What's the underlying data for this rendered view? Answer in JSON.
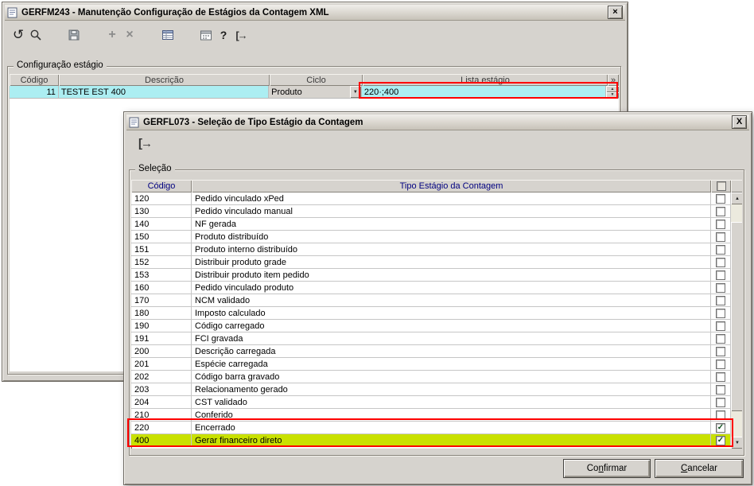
{
  "colors": {
    "annotation": "#ff0000",
    "selection_bg": "#aceef2",
    "highlight_row_bg": "#c9e100",
    "header_text": "#000080"
  },
  "glyphs": {
    "close": "×",
    "close2": "X",
    "refresh": "↺",
    "add": "+",
    "delete": "×",
    "help": "?",
    "exit": "[→",
    "up": "▲",
    "down": "▼",
    "check": "✓",
    "extra_col": "»"
  },
  "window1": {
    "title": "GERFM243 - Manutenção Configuração de Estágios da Contagem XML",
    "groupbox_label": "Configuração estágio",
    "grid": {
      "headers": {
        "codigo": "Código",
        "descricao": "Descrição",
        "ciclo": "Ciclo",
        "lista": "Lista estágio"
      },
      "row": {
        "codigo": "11",
        "descricao": "TESTE EST 400",
        "ciclo": "Produto",
        "lista": "220·;400"
      }
    }
  },
  "window2": {
    "title": "GERFL073 - Seleção de Tipo Estágio da Contagem",
    "groupbox_label": "Seleção",
    "grid": {
      "headers": {
        "codigo": "Código",
        "tipo": "Tipo Estágio da Contagem"
      },
      "rows": [
        {
          "codigo": "120",
          "tipo": "Pedido vinculado xPed",
          "checked": false,
          "highlight": false
        },
        {
          "codigo": "130",
          "tipo": "Pedido vinculado manual",
          "checked": false,
          "highlight": false
        },
        {
          "codigo": "140",
          "tipo": "NF gerada",
          "checked": false,
          "highlight": false
        },
        {
          "codigo": "150",
          "tipo": "Produto distribuído",
          "checked": false,
          "highlight": false
        },
        {
          "codigo": "151",
          "tipo": "Produto interno distribuído",
          "checked": false,
          "highlight": false
        },
        {
          "codigo": "152",
          "tipo": "Distribuir produto grade",
          "checked": false,
          "highlight": false
        },
        {
          "codigo": "153",
          "tipo": "Distribuir produto item pedido",
          "checked": false,
          "highlight": false
        },
        {
          "codigo": "160",
          "tipo": "Pedido vinculado produto",
          "checked": false,
          "highlight": false
        },
        {
          "codigo": "170",
          "tipo": "NCM validado",
          "checked": false,
          "highlight": false
        },
        {
          "codigo": "180",
          "tipo": "Imposto calculado",
          "checked": false,
          "highlight": false
        },
        {
          "codigo": "190",
          "tipo": "Código carregado",
          "checked": false,
          "highlight": false
        },
        {
          "codigo": "191",
          "tipo": "FCI gravada",
          "checked": false,
          "highlight": false
        },
        {
          "codigo": "200",
          "tipo": "Descrição carregada",
          "checked": false,
          "highlight": false
        },
        {
          "codigo": "201",
          "tipo": "Espécie carregada",
          "checked": false,
          "highlight": false
        },
        {
          "codigo": "202",
          "tipo": "Código barra gravado",
          "checked": false,
          "highlight": false
        },
        {
          "codigo": "203",
          "tipo": "Relacionamento gerado",
          "checked": false,
          "highlight": false
        },
        {
          "codigo": "204",
          "tipo": "CST validado",
          "checked": false,
          "highlight": false
        },
        {
          "codigo": "210",
          "tipo": "Conferido",
          "checked": false,
          "highlight": false
        },
        {
          "codigo": "220",
          "tipo": "Encerrado",
          "checked": true,
          "highlight": false
        },
        {
          "codigo": "400",
          "tipo": "Gerar financeiro direto",
          "checked": true,
          "highlight": true
        }
      ]
    },
    "buttons": {
      "confirm": {
        "pre": "Co",
        "accel": "n",
        "post": "firmar"
      },
      "cancel": {
        "pre": "",
        "accel": "C",
        "post": "ancelar"
      }
    }
  }
}
